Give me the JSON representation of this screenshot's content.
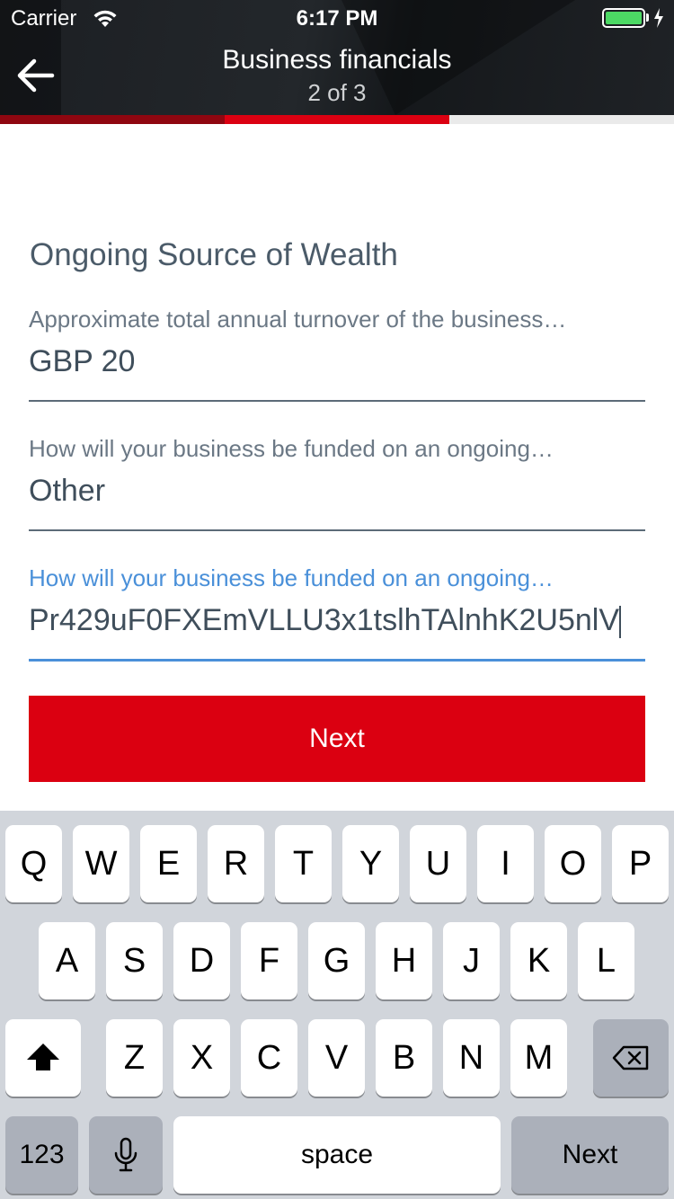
{
  "status_bar": {
    "carrier": "Carrier",
    "time": "6:17 PM",
    "battery_color": "#4cd964"
  },
  "nav": {
    "back_icon": "arrow-left-icon",
    "title": "Business financials",
    "step": "2 of 3"
  },
  "progress": {
    "current_step": 2,
    "total_steps": 3,
    "colors": {
      "done": "#8f0610",
      "current": "#db0011",
      "remaining": "#eaeaea"
    }
  },
  "form": {
    "section_title": "Ongoing Source of Wealth",
    "fields": [
      {
        "label": "Approximate total annual turnover of the business…",
        "value": "GBP 20"
      },
      {
        "label": "How will your business be funded on an ongoing…",
        "value": "Other"
      },
      {
        "label": "How will your business be funded on an ongoing…",
        "value": "Pr429uF0FXEmVLLU3x1tslhTAlnhK2U5nlV",
        "focused": true
      }
    ],
    "next_label": "Next"
  },
  "keyboard": {
    "row1": [
      "Q",
      "W",
      "E",
      "R",
      "T",
      "Y",
      "U",
      "I",
      "O",
      "P"
    ],
    "row2": [
      "A",
      "S",
      "D",
      "F",
      "G",
      "H",
      "J",
      "K",
      "L"
    ],
    "row3": [
      "Z",
      "X",
      "C",
      "V",
      "B",
      "N",
      "M"
    ],
    "numbers_label": "123",
    "space_label": "space",
    "return_label": "Next",
    "shift_icon": "shift-icon",
    "delete_icon": "backspace-icon",
    "mic_icon": "microphone-icon"
  },
  "colors": {
    "brand_red": "#db0011",
    "header_dark": "#1c1f23",
    "focus_blue": "#4a90d9",
    "text_primary": "#3f4e5b"
  }
}
